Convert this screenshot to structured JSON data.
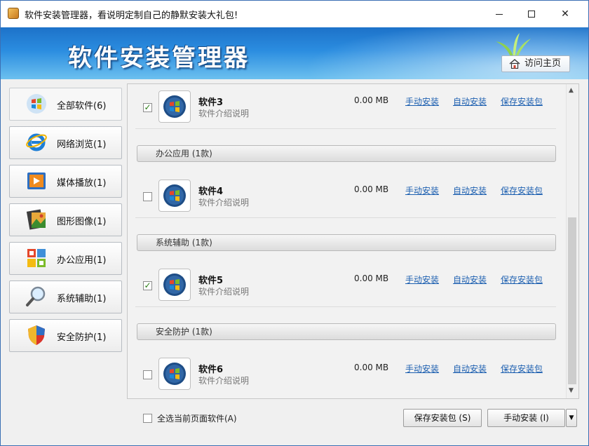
{
  "window": {
    "title": "软件安装管理器，看说明定制自己的静默安装大礼包!",
    "banner_title": "软件安装管理器",
    "home_button": "访问主页"
  },
  "sidebar": {
    "items": [
      {
        "label": "全部软件(6)",
        "icon": "windows-logo-icon"
      },
      {
        "label": "网络浏览(1)",
        "icon": "ie-browser-icon"
      },
      {
        "label": "媒体播放(1)",
        "icon": "media-player-icon"
      },
      {
        "label": "图形图像(1)",
        "icon": "image-film-icon"
      },
      {
        "label": "办公应用(1)",
        "icon": "office-apps-icon"
      },
      {
        "label": "系统辅助(1)",
        "icon": "magnifier-icon"
      },
      {
        "label": "安全防护(1)",
        "icon": "shield-icon"
      }
    ]
  },
  "list": {
    "rows": [
      {
        "name": "软件3",
        "desc": "软件介绍说明",
        "size": "0.00 MB",
        "checked": true
      },
      {
        "name": "软件4",
        "desc": "软件介绍说明",
        "size": "0.00 MB",
        "checked": false
      },
      {
        "name": "软件5",
        "desc": "软件介绍说明",
        "size": "0.00 MB",
        "checked": true
      },
      {
        "name": "软件6",
        "desc": "软件介绍说明",
        "size": "0.00 MB",
        "checked": false
      }
    ],
    "categories": [
      "办公应用 (1款)",
      "系统辅助 (1款)",
      "安全防护 (1款)"
    ],
    "link_manual": "手动安装",
    "link_auto": "自动安装",
    "link_save": "保存安装包"
  },
  "bottom": {
    "select_all": "全选当前页面软件(A)",
    "save_button": "保存安装包 (S)",
    "manual_button": "手动安装 (I)"
  },
  "colors": {
    "banner": "#2b8de0",
    "link": "#1c5fb0",
    "check": "#2a7d14"
  }
}
